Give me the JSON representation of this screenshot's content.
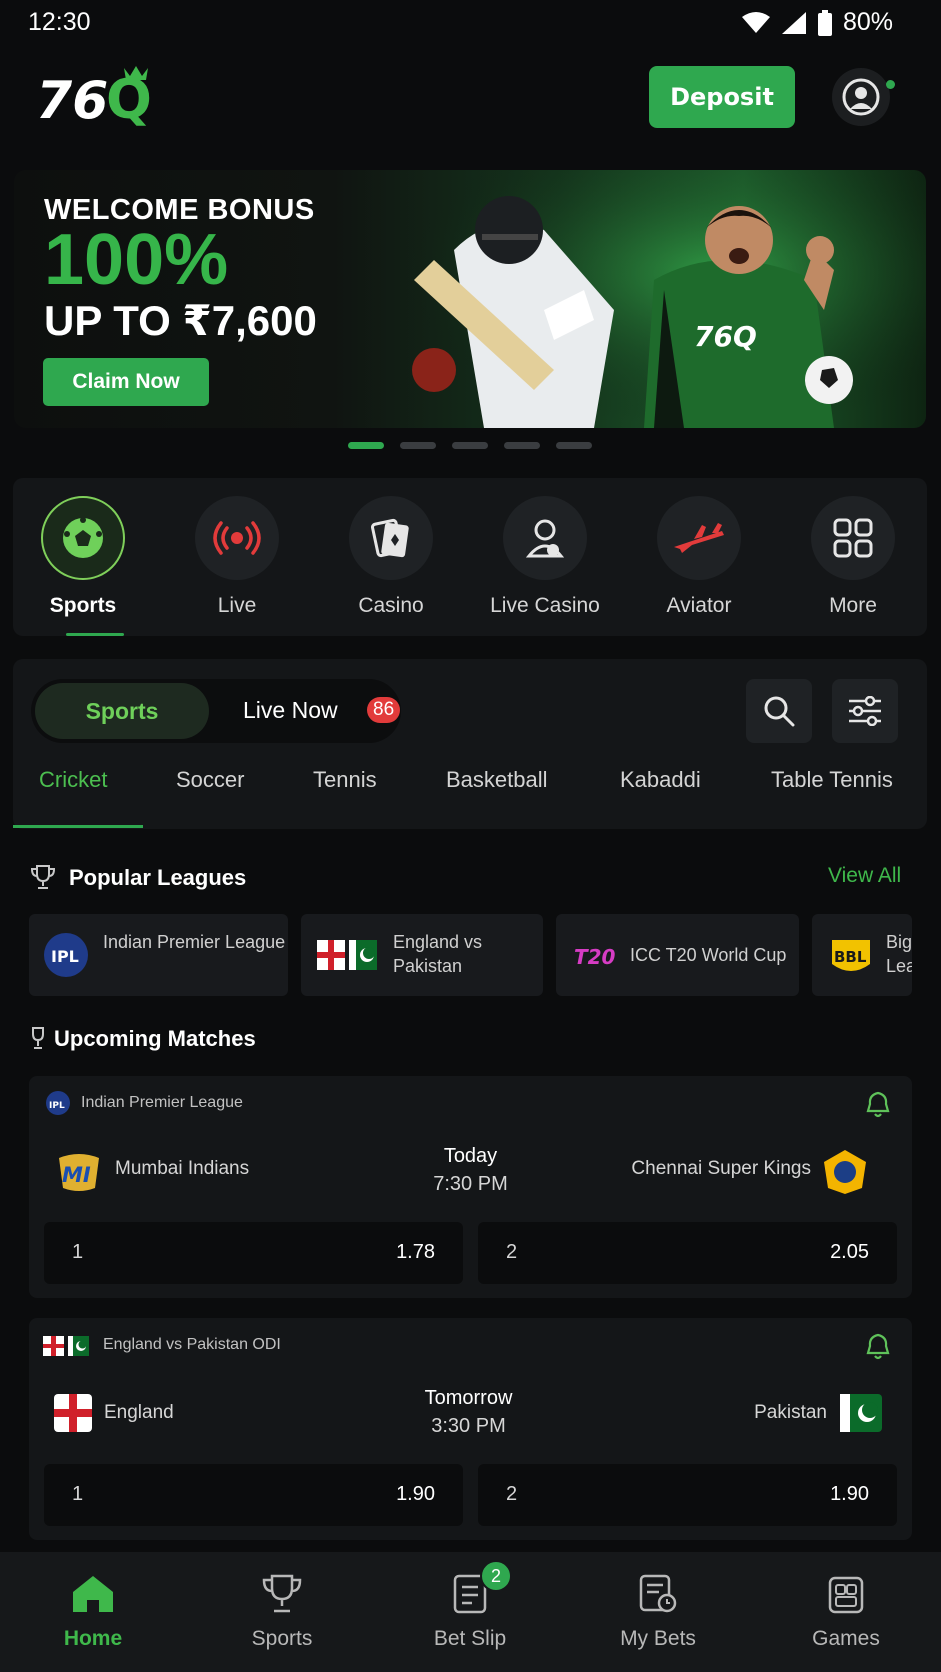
{
  "status": {
    "time": "12:30",
    "battery": "80%"
  },
  "header": {
    "logo": "76Q",
    "deposit_label": "Deposit"
  },
  "banner": {
    "line1": "WELCOME BONUS",
    "line2": "100%",
    "line3": "UP TO ₹7,600",
    "cta": "Claim Now",
    "jersey_text": "76Q",
    "slides": 5,
    "active_slide": 1
  },
  "categories": [
    {
      "label": "Sports",
      "icon": "soccer-ball-icon",
      "active": true
    },
    {
      "label": "Live",
      "icon": "broadcast-icon"
    },
    {
      "label": "Casino",
      "icon": "cards-icon"
    },
    {
      "label": "Live Casino",
      "icon": "dealer-icon"
    },
    {
      "label": "Aviator",
      "icon": "plane-icon"
    },
    {
      "label": "More",
      "icon": "grid-icon"
    }
  ],
  "sports_panel": {
    "segment_active": "Sports",
    "segment_other": "Live Now",
    "live_count": "86",
    "tabs": [
      "Cricket",
      "Soccer",
      "Tennis",
      "Basketball",
      "Kabaddi",
      "Table Tennis"
    ],
    "active_tab": "Cricket"
  },
  "popular": {
    "title": "Popular Leagues",
    "view_all": "View All",
    "leagues": [
      {
        "name": "Indian Premier League",
        "logo": "IPL"
      },
      {
        "name": "England vs Pakistan",
        "logo": "flags"
      },
      {
        "name": "ICC T20 World Cup",
        "logo": "T20"
      },
      {
        "name": "Big Lea",
        "logo": "BBL"
      }
    ]
  },
  "upcoming": {
    "title": "Upcoming Matches",
    "matches": [
      {
        "league": "Indian Premier League",
        "home": "Mumbai Indians",
        "home_logo": "MI",
        "day": "Today",
        "time": "7:30 PM",
        "away": "Chennai Super Kings",
        "odds": [
          {
            "k": "1",
            "v": "1.78"
          },
          {
            "k": "2",
            "v": "2.05"
          }
        ]
      },
      {
        "league": "England vs Pakistan ODI",
        "home": "England",
        "day": "Tomorrow",
        "time": "3:30 PM",
        "away": "Pakistan",
        "odds": [
          {
            "k": "1",
            "v": "1.90"
          },
          {
            "k": "2",
            "v": "1.90"
          }
        ]
      }
    ]
  },
  "bottom_nav": [
    {
      "label": "Home",
      "icon": "home-icon",
      "active": true
    },
    {
      "label": "Sports",
      "icon": "trophy-icon"
    },
    {
      "label": "Bet Slip",
      "icon": "betslip-icon",
      "badge": "2"
    },
    {
      "label": "My Bets",
      "icon": "mybets-icon"
    },
    {
      "label": "Games",
      "icon": "games-icon"
    }
  ],
  "colors": {
    "accent": "#2fa84f",
    "bg": "#0b0c0d",
    "card": "#141618",
    "live_badge": "#e23b3b"
  }
}
